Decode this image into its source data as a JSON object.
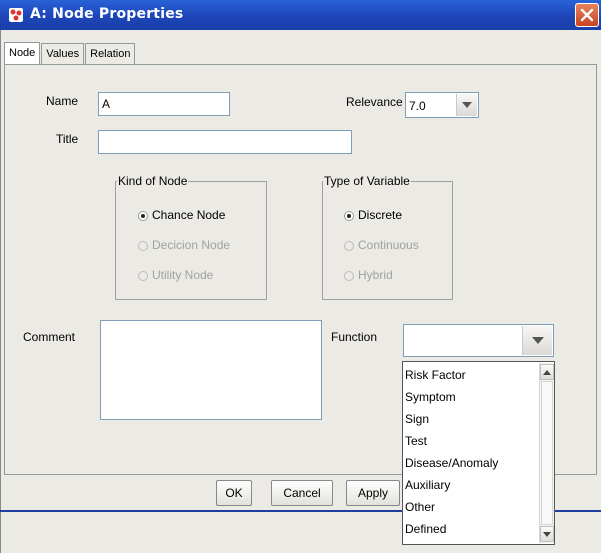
{
  "window": {
    "title": "A: Node Properties",
    "icon": "app-icon",
    "close_icon": "close-icon"
  },
  "tabs": [
    {
      "label": "Node",
      "active": true
    },
    {
      "label": "Values",
      "active": false
    },
    {
      "label": "Relation",
      "active": false
    }
  ],
  "form": {
    "name_label": "Name",
    "name_value": "A",
    "relevance_label": "Relevance",
    "relevance_value": "7.0",
    "title_label": "Title",
    "title_value": "",
    "comment_label": "Comment",
    "comment_value": "",
    "function_label": "Function",
    "function_value": ""
  },
  "kind_of_node": {
    "legend": "Kind of Node",
    "options": [
      {
        "label": "Chance Node",
        "selected": true,
        "enabled": true
      },
      {
        "label": "Decicion Node",
        "selected": false,
        "enabled": false
      },
      {
        "label": "Utility Node",
        "selected": false,
        "enabled": false
      }
    ]
  },
  "type_of_variable": {
    "legend": "Type of Variable",
    "options": [
      {
        "label": "Discrete",
        "selected": true,
        "enabled": true
      },
      {
        "label": "Continuous",
        "selected": false,
        "enabled": false
      },
      {
        "label": "Hybrid",
        "selected": false,
        "enabled": false
      }
    ]
  },
  "function_dropdown": {
    "items": [
      "Risk Factor",
      "Symptom",
      "Sign",
      "Test",
      "Disease/Anomaly",
      "Auxiliary",
      "Other",
      "Defined"
    ]
  },
  "buttons": {
    "ok": "OK",
    "cancel": "Cancel",
    "apply": "Apply"
  },
  "colors": {
    "titlebar": "#1c45b8",
    "window_bg": "#eceae4",
    "close_button": "#d2542c"
  }
}
